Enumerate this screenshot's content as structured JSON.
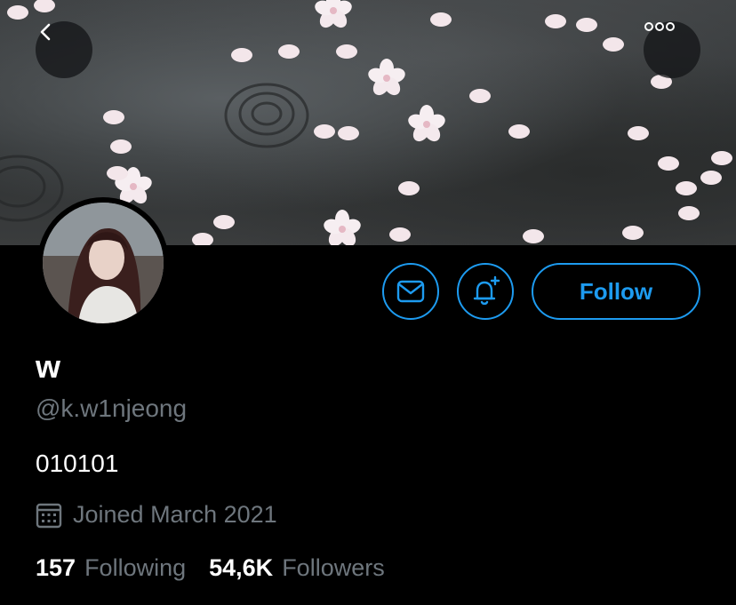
{
  "profile": {
    "display_name": "w",
    "handle": "@k.w1njeong",
    "bio": "010101",
    "joined": "Joined March 2021"
  },
  "actions": {
    "follow_label": "Follow"
  },
  "stats": {
    "following_count": "157",
    "following_label": "Following",
    "followers_count": "54,6K",
    "followers_label": "Followers"
  },
  "icons": {
    "back": "chevron-left-icon",
    "more": "more-horizontal-icon",
    "message": "envelope-icon",
    "notify": "bell-plus-icon",
    "calendar": "calendar-icon"
  },
  "colors": {
    "accent": "#1d9bf0",
    "muted_text": "#6e767d",
    "background": "#000000"
  }
}
